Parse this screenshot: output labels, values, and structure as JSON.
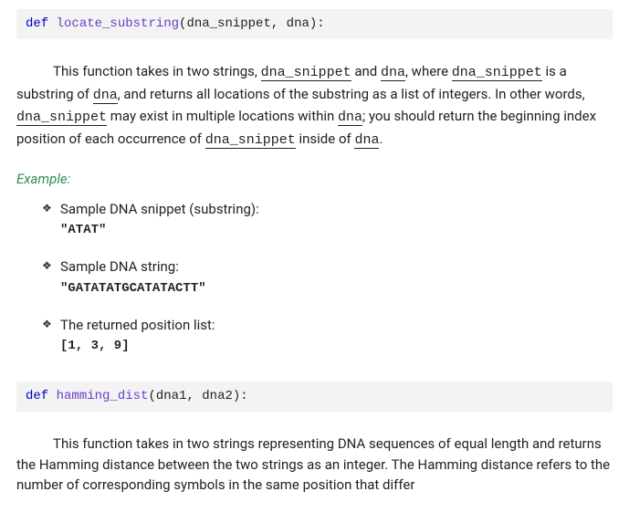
{
  "func1": {
    "def_kw": "def",
    "name": "locate_substring",
    "params": "(dna_snippet, dna):",
    "desc_prefix": "This function takes in two strings, ",
    "arg1": "dna_snippet",
    "desc_mid1": " and ",
    "arg2": "dna",
    "desc_mid2": ", where ",
    "arg1b": "dna_snippet",
    "desc_mid3": " is a substring of ",
    "arg2b": "dna",
    "desc_mid4": ", and returns all locations of the substring as a list of integers. In other words, ",
    "arg1c": "dna_snippet",
    "desc_mid5": " may exist in multiple locations within ",
    "arg2c": "dna",
    "desc_mid6": "; you should return the beginning index position of each occurrence of ",
    "arg1d": "dna_snippet",
    "desc_mid7": " inside of ",
    "arg2d": "dna",
    "desc_end": "."
  },
  "example_label": "Example:",
  "bullets": [
    {
      "label": "Sample DNA snippet (substring):",
      "code": "\"ATAT\""
    },
    {
      "label": "Sample DNA string:",
      "code": "\"GATATATGCATATACTT\""
    },
    {
      "label": "The returned position list:",
      "code": "[1, 3, 9]"
    }
  ],
  "func2": {
    "def_kw": "def",
    "name": "hamming_dist",
    "params": "(dna1, dna2):",
    "desc": "This function takes in two strings representing DNA sequences of equal length and returns the Hamming distance between the two strings as an integer. The Hamming distance refers to the number of corresponding symbols in the same position that differ"
  }
}
